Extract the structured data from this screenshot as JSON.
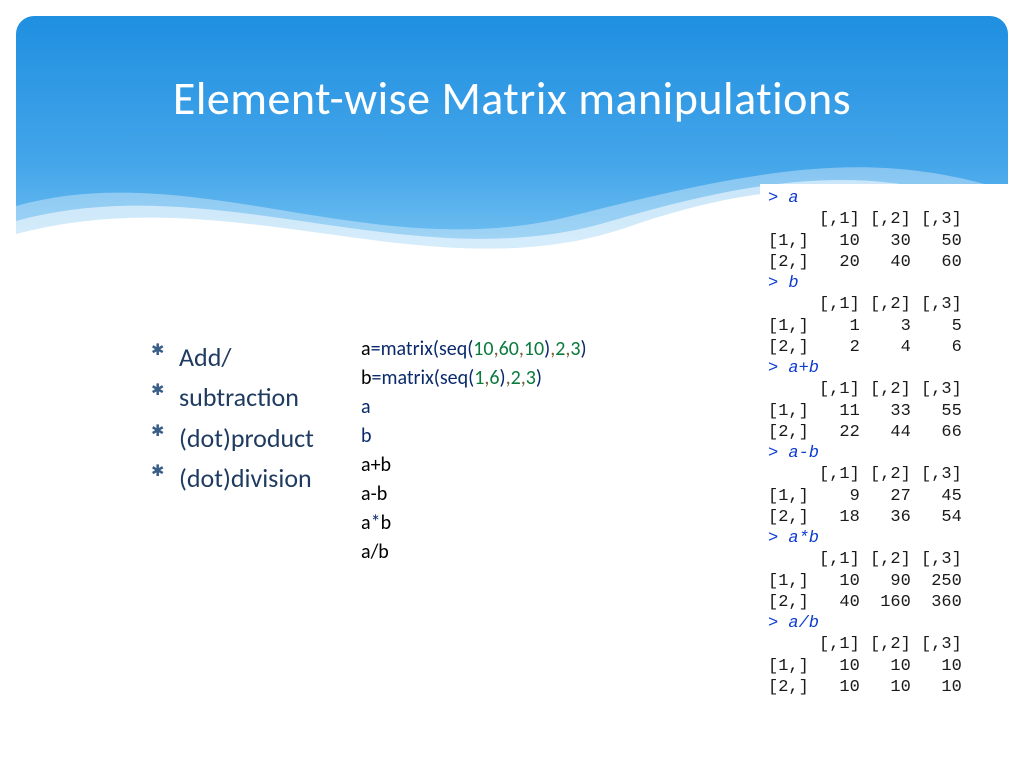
{
  "title": "Element-wise Matrix manipulations",
  "bullets": [
    "Add/",
    "subtraction",
    "(dot)product",
    "(dot)division"
  ],
  "code": {
    "l1": {
      "a": "a",
      "eq": "=",
      "fn": "matrix",
      "op": "(",
      "sq": "seq",
      "op2": "(",
      "n1": "10",
      "c1": ",",
      "n2": "60",
      "c2": ",",
      "n3": "10",
      "cp": ")",
      "c3": ",",
      "n4": "2",
      "c4": ",",
      "n5": "3",
      "cp2": ")"
    },
    "l2": {
      "b": "b",
      "eq": "=",
      "fn": "matrix",
      "op": "(",
      "sq": "seq",
      "op2": "(",
      "n1": "1",
      "c1": ",",
      "n2": "6",
      "cp": ")",
      "c2": ",",
      "n3": "2",
      "c3": ",",
      "n4": "3",
      "cp2": ")"
    },
    "l3": "a",
    "l4": "b",
    "l5": "a+b",
    "l6": "a-b",
    "l7": {
      "a": "a",
      "star": "*",
      "b": "b"
    },
    "l8": "a/b"
  },
  "console": {
    "pa": "> a",
    "hdr": "     [,1] [,2] [,3]",
    "a_r1": "[1,]   10   30   50",
    "a_r2": "[2,]   20   40   60",
    "pb": "> b",
    "b_r1": "[1,]    1    3    5",
    "b_r2": "[2,]    2    4    6",
    "pab": "> a+b",
    "ab_r1": "[1,]   11   33   55",
    "ab_r2": "[2,]   22   44   66",
    "pamb": "> a-b",
    "amb_r1": "[1,]    9   27   45",
    "amb_r2": "[2,]   18   36   54",
    "patb": "> a*b",
    "atb_hdr": "     [,1] [,2] [,3]",
    "atb_r1": "[1,]   10   90  250",
    "atb_r2": "[2,]   40  160  360",
    "padb": "> a/b",
    "adb_r1": "[1,]   10   10   10",
    "adb_r2": "[2,]   10   10   10"
  }
}
